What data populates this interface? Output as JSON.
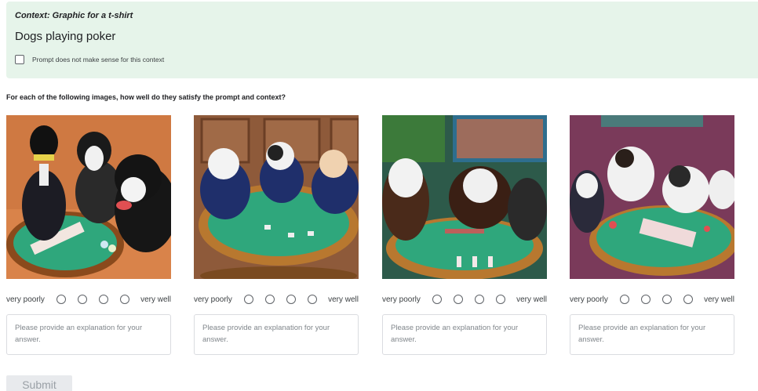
{
  "context": {
    "label": "Context: Graphic for a t-shirt",
    "prompt": "Dogs playing poker",
    "nonsense_checkbox_label": "Prompt does not make sense for this context"
  },
  "question": "For each of the following images, how well do they satisfy the prompt and context?",
  "rating": {
    "low_label": "very poorly",
    "high_label": "very well",
    "option_count": 4
  },
  "explanation_placeholder": "Please provide an explanation for your answer.",
  "submit_label": "Submit",
  "colors": {
    "context_bg": "#e6f4ea",
    "table_felt": "#2fa77c",
    "table_rim": "#b8782f"
  }
}
